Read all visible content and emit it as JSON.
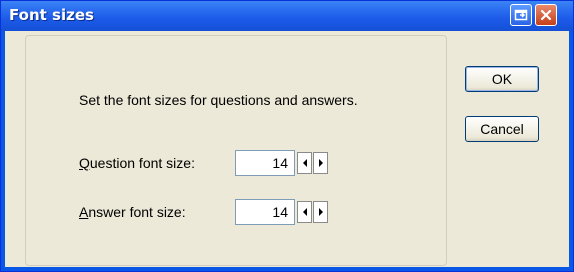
{
  "window": {
    "title": "Font sizes",
    "restore_icon": "restore-icon",
    "close_icon": "close-icon"
  },
  "dialog": {
    "message": "Set the font sizes for questions and answers.",
    "question_label_mnemonic": "Q",
    "question_label_rest": "uestion font size:",
    "question_value": "14",
    "answer_label_mnemonic": "A",
    "answer_label_rest": "nswer font size:",
    "answer_value": "14"
  },
  "buttons": {
    "ok": "OK",
    "cancel": "Cancel"
  },
  "colors": {
    "titlebar": "#1c5ae8",
    "client": "#ece9d8",
    "close": "#c4401a"
  }
}
